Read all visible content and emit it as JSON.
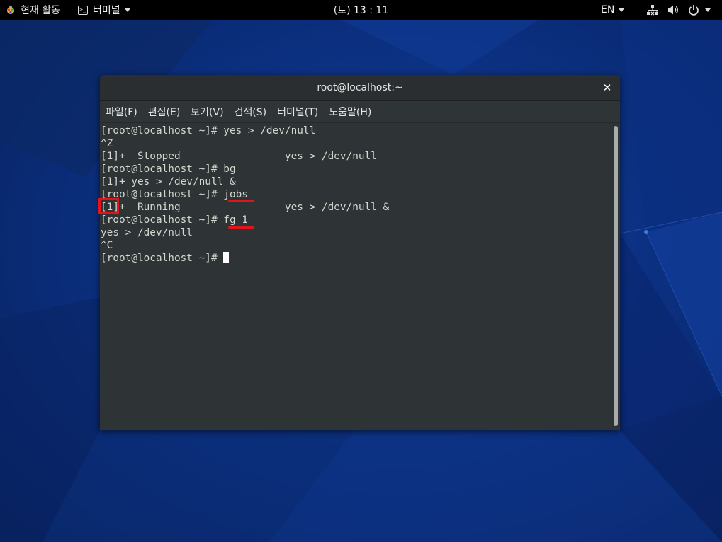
{
  "top_panel": {
    "activities_label": "현재 활동",
    "app_menu_label": "터미널",
    "clock": "(토) 13 : 11",
    "language": "EN"
  },
  "window": {
    "title": "root@localhost:~",
    "close_glyph": "✕",
    "menu": [
      "파일(F)",
      "편집(E)",
      "보기(V)",
      "검색(S)",
      "터미널(T)",
      "도움말(H)"
    ]
  },
  "terminal": {
    "lines": [
      "[root@localhost ~]# yes > /dev/null",
      "^Z",
      "[1]+  Stopped                 yes > /dev/null",
      "[root@localhost ~]# bg",
      "[1]+ yes > /dev/null &",
      "[root@localhost ~]# jobs",
      "[1]+  Running                 yes > /dev/null &",
      "[root@localhost ~]# fg 1",
      "yes > /dev/null",
      "^C"
    ],
    "prompt": "[root@localhost ~]# "
  },
  "icons": {
    "activities": "gnome-foot-icon",
    "app_menu": "terminal-icon",
    "network": "network-wired-icon",
    "volume": "speaker-icon",
    "power": "power-icon"
  },
  "colors": {
    "annotation": "#e0151c",
    "terminal_bg": "#2e3436",
    "terminal_fg": "#d3d7cf"
  }
}
